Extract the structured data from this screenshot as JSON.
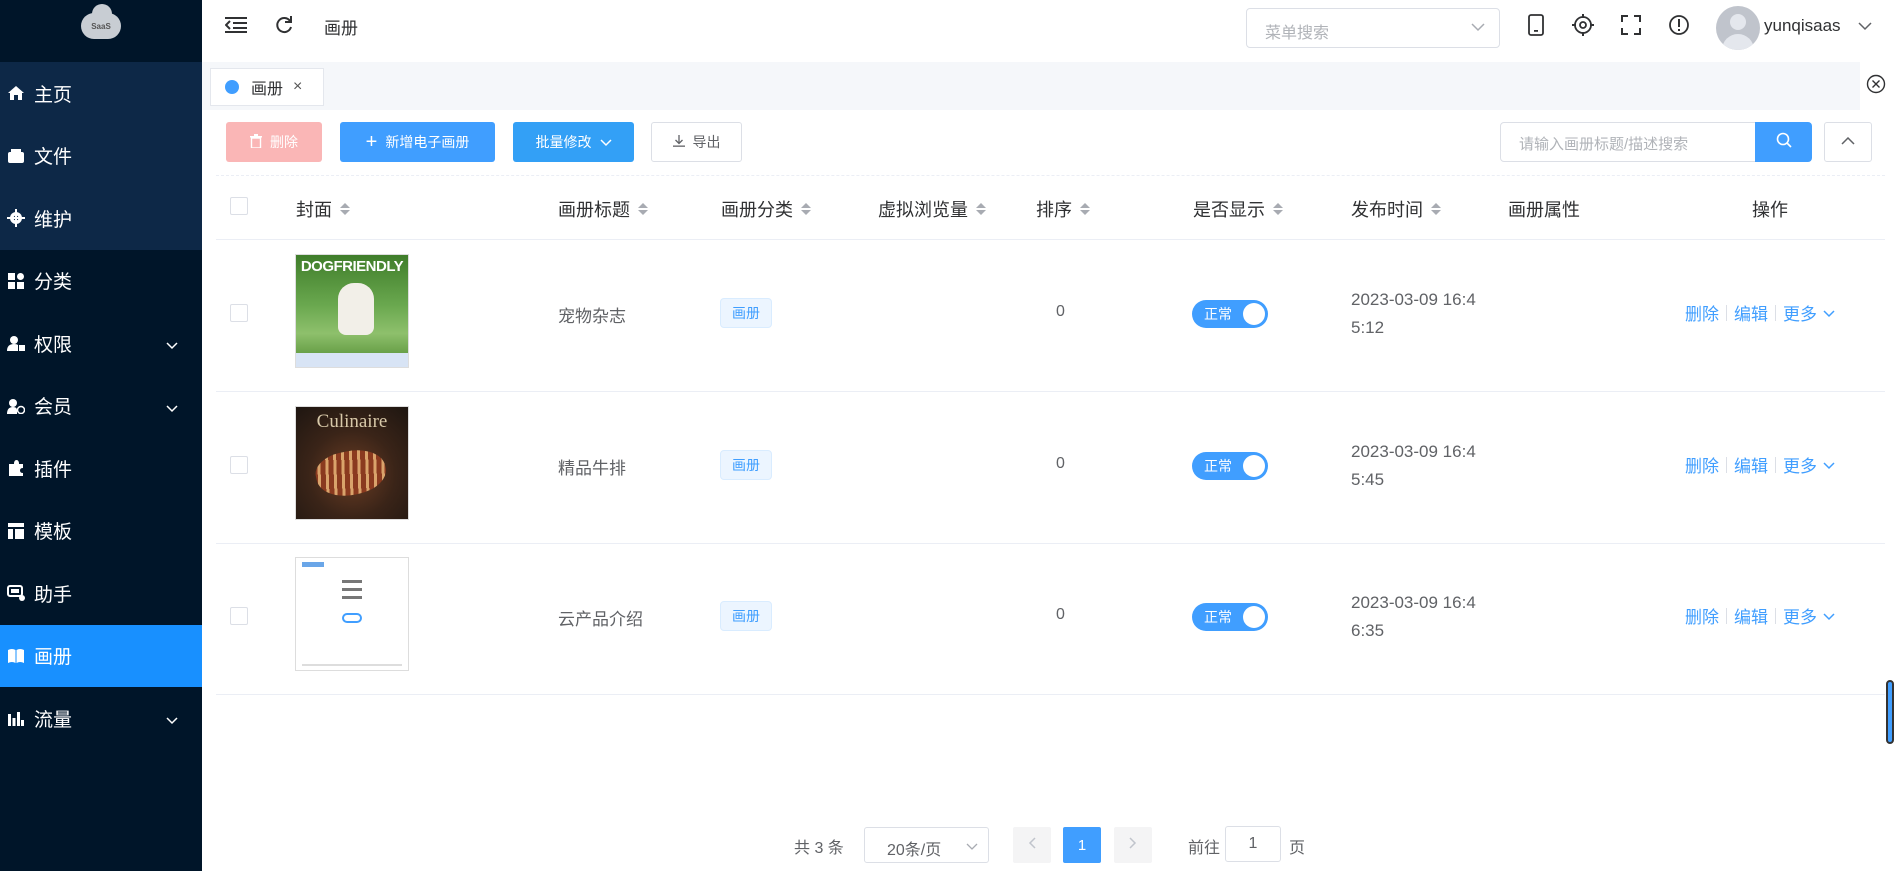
{
  "sidebar": {
    "logo_text": "SaaS",
    "items": [
      {
        "label": "主页",
        "icon": "home-icon",
        "expandable": false
      },
      {
        "label": "文件",
        "icon": "file-icon",
        "expandable": false
      },
      {
        "label": "维护",
        "icon": "gear-icon",
        "expandable": false
      },
      {
        "label": "分类",
        "icon": "grid-icon",
        "expandable": false
      },
      {
        "label": "权限",
        "icon": "user-lock-icon",
        "expandable": true
      },
      {
        "label": "会员",
        "icon": "member-icon",
        "expandable": true
      },
      {
        "label": "插件",
        "icon": "puzzle-icon",
        "expandable": false
      },
      {
        "label": "模板",
        "icon": "template-icon",
        "expandable": false
      },
      {
        "label": "助手",
        "icon": "assistant-icon",
        "expandable": false
      },
      {
        "label": "画册",
        "icon": "book-icon",
        "expandable": false,
        "active": true
      },
      {
        "label": "流量",
        "icon": "bar-chart-icon",
        "expandable": true
      }
    ]
  },
  "header": {
    "breadcrumb": "画册",
    "menu_search_placeholder": "菜单搜索",
    "username": "yunqisaas"
  },
  "tabs": [
    {
      "label": "画册",
      "active": true
    }
  ],
  "toolbar": {
    "delete_label": "删除",
    "add_label": "新增电子画册",
    "batch_label": "批量修改",
    "export_label": "导出",
    "search_placeholder": "请输入画册标题/描述搜索"
  },
  "table": {
    "columns": [
      "封面",
      "画册标题",
      "画册分类",
      "虚拟浏览量",
      "排序",
      "是否显示",
      "发布时间",
      "画册属性",
      "操作"
    ],
    "rows": [
      {
        "cover": "DOGFRIENDLY",
        "title": "宠物杂志",
        "category": "画册",
        "views": "",
        "sort": "0",
        "status": "正常",
        "time_line1": "2023-03-09 16:4",
        "time_line2": "5:12",
        "attrs": ""
      },
      {
        "cover": "Culinaire",
        "title": "精品牛排",
        "category": "画册",
        "views": "",
        "sort": "0",
        "status": "正常",
        "time_line1": "2023-03-09 16:4",
        "time_line2": "5:45",
        "attrs": ""
      },
      {
        "cover": "",
        "title": "云产品介绍",
        "category": "画册",
        "views": "",
        "sort": "0",
        "status": "正常",
        "time_line1": "2023-03-09 16:4",
        "time_line2": "6:35",
        "attrs": ""
      }
    ],
    "actions": {
      "delete": "删除",
      "edit": "编辑",
      "more": "更多"
    }
  },
  "pagination": {
    "total_text": "共 3 条",
    "page_size": "20条/页",
    "current_page": "1",
    "goto_prefix": "前往",
    "goto_value": "1",
    "goto_suffix": "页"
  },
  "colors": {
    "primary": "#409eff",
    "sidebar_bg": "#001529",
    "sidebar_active": "#1890ff",
    "danger_light": "#fab6b6"
  }
}
